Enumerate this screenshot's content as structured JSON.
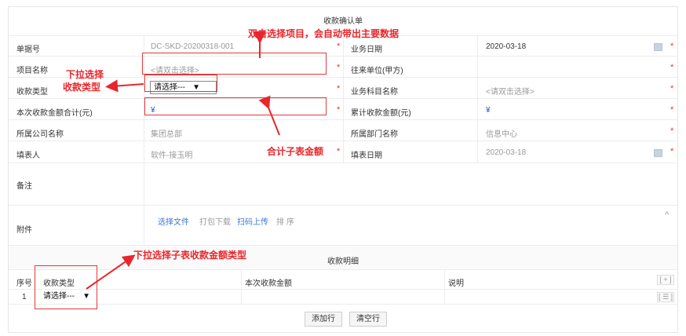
{
  "form": {
    "title": "收款确认单",
    "bill_no_label": "单据号",
    "bill_no_value": "DC-SKD-20200318-001",
    "biz_date_label": "业务日期",
    "biz_date_value": "2020-03-18",
    "project_label": "项目名称",
    "project_placeholder": "<请双击选择>",
    "partner_label": "往来单位(甲方)",
    "receipt_type_label": "收款类型",
    "receipt_type_value": "请选择---",
    "subject_label": "业务科目名称",
    "subject_placeholder": "<请双击选择>",
    "total_label": "本次收款金额合计(元)",
    "total_value": "¥",
    "cumulative_label": "累计收款金额(元)",
    "cumulative_value": "¥",
    "company_label": "所属公司名称",
    "company_value": "集团总部",
    "dept_label": "所属部门名称",
    "dept_value": "信息中心",
    "filler_label": "填表人",
    "filler_value": "软件-接玉明",
    "fill_date_label": "填表日期",
    "fill_date_value": "2020-03-18",
    "remarks_label": "备注",
    "attach_label": "附件",
    "attach_select": "选择文件",
    "attach_pack": "打包下载",
    "attach_scan": "扫码上传",
    "attach_sort": "排 序",
    "required_mark": "*",
    "collapse_glyph": "^"
  },
  "detail": {
    "title": "收款明细",
    "columns": [
      "序号",
      "收款类型",
      "本次收款金额",
      "说明"
    ],
    "rows": [
      {
        "index": "1",
        "type": "请选择---"
      }
    ],
    "add_glyph": "[ + ]",
    "row_menu_glyph": "[ ☰ ]",
    "add_row_button": "添加行",
    "clear_rows_button": "清空行"
  },
  "annotations": {
    "double_click": "双击选择项目，会自动带出主要数据",
    "dropdown_type_line1": "下拉选择",
    "dropdown_type_line2": "收款类型",
    "sum_amount": "合计子表金额",
    "dropdown_detail": "下拉选择子表收款金额类型"
  },
  "colors": {
    "annotation_red": "#e8262b",
    "link_blue": "#3a79d4",
    "required_red": "#e33"
  }
}
